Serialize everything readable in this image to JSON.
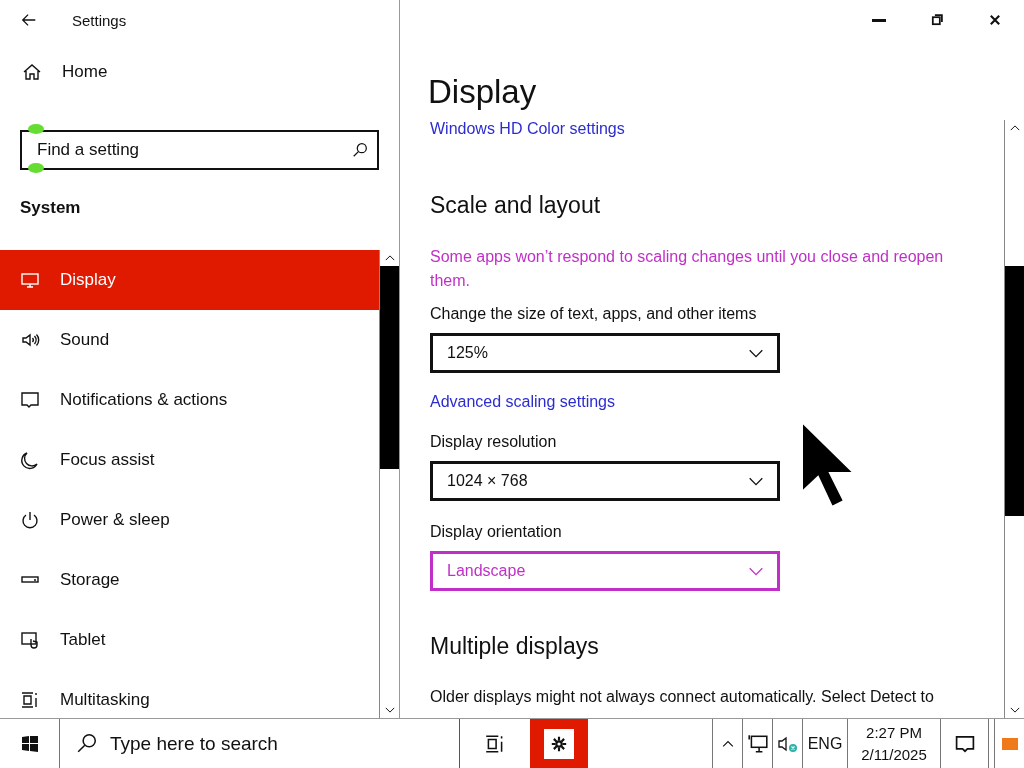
{
  "window": {
    "title": "Settings"
  },
  "sidebar": {
    "home": "Home",
    "search": {
      "placeholder": "Find a setting"
    },
    "section": "System",
    "items": [
      {
        "label": "Display",
        "selected": true
      },
      {
        "label": "Sound",
        "selected": false
      },
      {
        "label": "Notifications & actions",
        "selected": false
      },
      {
        "label": "Focus assist",
        "selected": false
      },
      {
        "label": "Power & sleep",
        "selected": false
      },
      {
        "label": "Storage",
        "selected": false
      },
      {
        "label": "Tablet",
        "selected": false
      },
      {
        "label": "Multitasking",
        "selected": false
      }
    ]
  },
  "page": {
    "title": "Display",
    "top_link": "Windows HD Color settings",
    "section": "Scale and layout",
    "notice": "Some apps won’t respond to scaling changes until you close and reopen them.",
    "scale_label": "Change the size of text, apps, and other items",
    "scale": {
      "value": "125%",
      "highlighted": false
    },
    "advanced_link": "Advanced scaling settings",
    "resolution_label": "Display resolution",
    "resolution": {
      "value": "1024 × 768",
      "highlighted": false
    },
    "orientation_label": "Display orientation",
    "orientation": {
      "value": "Landscape",
      "highlighted": true
    },
    "section_2": "Multiple displays",
    "multi_text": "Older displays might not always connect automatically. Select Detect to"
  },
  "taskbar": {
    "search": {
      "placeholder": "Type here to search"
    },
    "apps": [
      {
        "kind": "task-view",
        "selected": false
      },
      {
        "kind": "settings",
        "selected": true
      }
    ],
    "language": "ENG",
    "time": "2:27 PM",
    "date": "2/11/2025"
  }
}
